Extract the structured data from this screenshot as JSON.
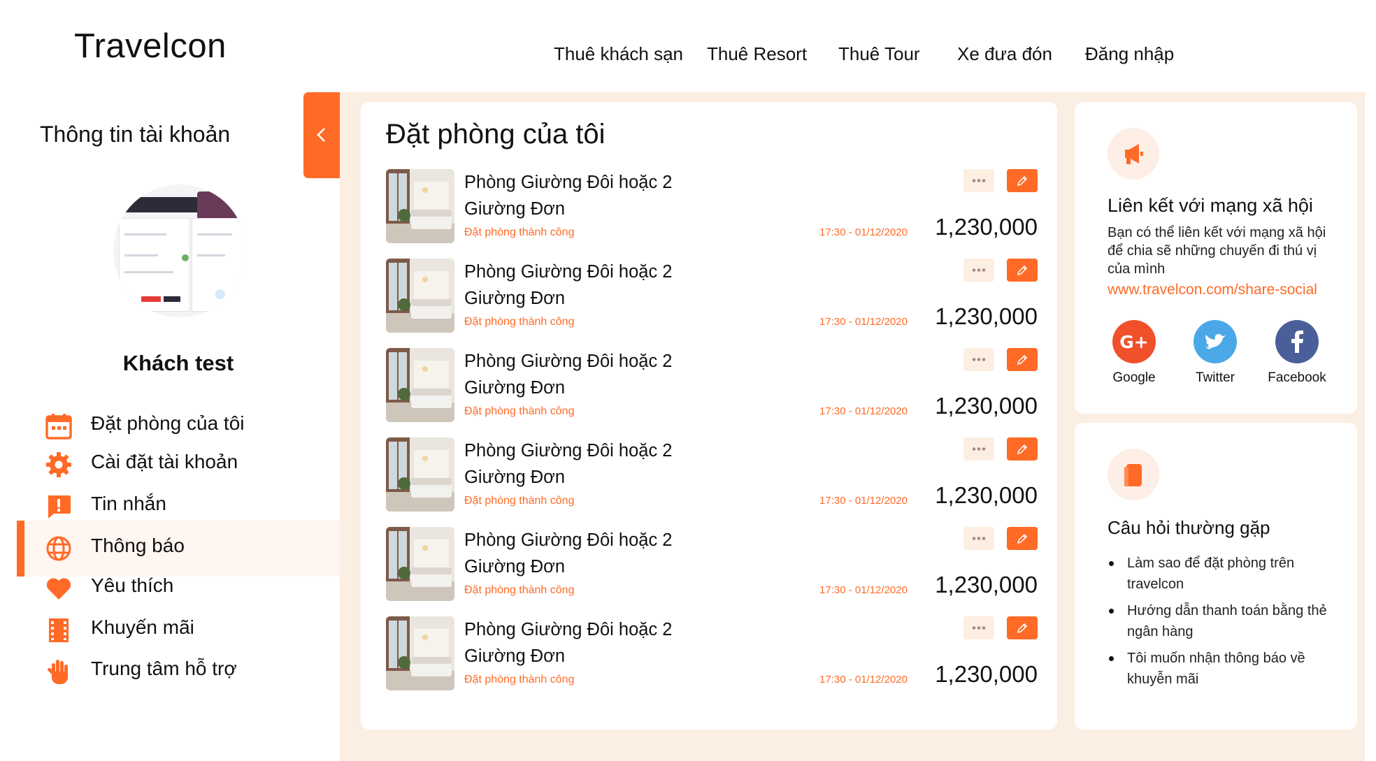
{
  "brand": {
    "name": "Travelcon",
    "accent": "#ff6a26",
    "panel_bg": "#fbeee2"
  },
  "nav": {
    "items": [
      {
        "label": "Thuê khách sạn"
      },
      {
        "label": "Thuê Resort"
      },
      {
        "label": "Thuê Tour"
      },
      {
        "label": "Xe đưa đón"
      },
      {
        "label": "Đăng nhập"
      }
    ]
  },
  "sidebar": {
    "title": "Thông tin tài khoản",
    "user_name": "Khách test",
    "toggle_icon": "chevron-left-icon",
    "items": [
      {
        "label": "Đặt phòng của tôi",
        "icon": "calendar-icon",
        "active": false
      },
      {
        "label": "Cài đặt tài khoản",
        "icon": "gear-icon",
        "active": false
      },
      {
        "label": "Tin nhắn",
        "icon": "message-alert-icon",
        "active": false
      },
      {
        "label": "Thông báo",
        "icon": "globe-icon",
        "active": true
      },
      {
        "label": "Yêu thích",
        "icon": "heart-icon",
        "active": false
      },
      {
        "label": "Khuyến mãi",
        "icon": "film-icon",
        "active": false
      },
      {
        "label": "Trung tâm hỗ trợ",
        "icon": "hand-icon",
        "active": false
      }
    ]
  },
  "main": {
    "title": "Đặt phòng của tôi",
    "bookings": [
      {
        "name": "Phòng Giường Đôi hoặc 2 Giường Đơn",
        "status": "Đặt phòng thành công",
        "time": "17:30 - 01/12/2020",
        "price": "1,230,000"
      },
      {
        "name": "Phòng Giường Đôi hoặc 2 Giường Đơn",
        "status": "Đặt phòng thành công",
        "time": "17:30 - 01/12/2020",
        "price": "1,230,000"
      },
      {
        "name": "Phòng Giường Đôi hoặc 2 Giường Đơn",
        "status": "Đặt phòng thành công",
        "time": "17:30 - 01/12/2020",
        "price": "1,230,000"
      },
      {
        "name": "Phòng Giường Đôi hoặc 2 Giường Đơn",
        "status": "Đặt phòng thành công",
        "time": "17:30 - 01/12/2020",
        "price": "1,230,000"
      },
      {
        "name": "Phòng Giường Đôi hoặc 2 Giường Đơn",
        "status": "Đặt phòng thành công",
        "time": "17:30 - 01/12/2020",
        "price": "1,230,000"
      },
      {
        "name": "Phòng Giường Đôi hoặc 2 Giường Đơn",
        "status": "Đặt phòng thành công",
        "time": "17:30 - 01/12/2020",
        "price": "1,230,000"
      }
    ]
  },
  "social_card": {
    "icon": "megaphone-icon",
    "title": "Liên kết với mạng xã hội",
    "description": "Bạn có thể liên kết với mạng xã hội để chia sẽ những chuyến đi thú vị của mình",
    "link": "www.travelcon.com/share-social",
    "networks": [
      {
        "label": "Google",
        "color": "#f0502a",
        "icon": "google-plus-icon"
      },
      {
        "label": "Twitter",
        "color": "#4aa8e8",
        "icon": "twitter-icon"
      },
      {
        "label": "Facebook",
        "color": "#4a5f9a",
        "icon": "facebook-icon"
      }
    ]
  },
  "faq_card": {
    "icon": "book-icon",
    "title": "Câu hỏi thường gặp",
    "items": [
      {
        "text": "Làm sao để đặt phòng trên travelcon"
      },
      {
        "text": "Hướng dẫn thanh toán bằng thẻ ngân hàng"
      },
      {
        "text": "Tôi muốn nhận thông báo về khuyễn mãi"
      }
    ]
  }
}
